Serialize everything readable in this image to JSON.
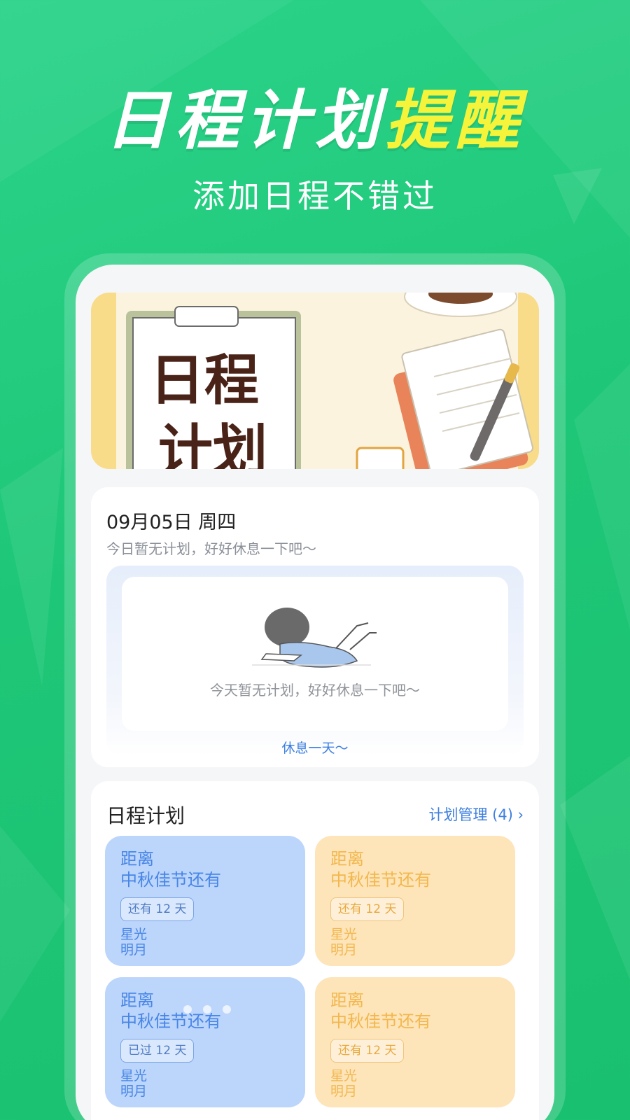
{
  "promo": {
    "title_main": "日程计划",
    "title_highlight": "提醒",
    "subtitle": "添加日程不错过"
  },
  "banner": {
    "clipboard_line1": "日程",
    "clipboard_line2": "计划"
  },
  "today": {
    "date": "09月05日 周四",
    "summary": "今日暂无计划，好好休息一下吧～",
    "empty_text": "今天暂无计划，好好休息一下吧～",
    "rest_link": "休息一天～"
  },
  "plans": {
    "title": "日程计划",
    "manage_label": "计划管理 (4) ›",
    "items": [
      {
        "line1": "距离",
        "line2": "中秋佳节还有",
        "badge": "还有 12 天",
        "line3": "星光",
        "line4": "明月",
        "color": "#bcd5fb"
      },
      {
        "line1": "距离",
        "line2": "中秋佳节还有",
        "badge": "还有 12 天",
        "line3": "星光",
        "line4": "明月",
        "color": "#fde4b9"
      },
      {
        "line1": "距离",
        "line2": "中秋佳节还有",
        "badge": "已过 12 天",
        "line3": "星光",
        "line4": "明月",
        "color": "#bcd5fb"
      },
      {
        "line1": "距离",
        "line2": "中秋佳节还有",
        "badge": "还有 12 天",
        "line3": "星光",
        "line4": "明月",
        "color": "#fde4b9"
      }
    ]
  },
  "colors": {
    "background": "#1ec777",
    "highlight": "#f5f33a",
    "accent_blue": "#3d7fe0"
  }
}
